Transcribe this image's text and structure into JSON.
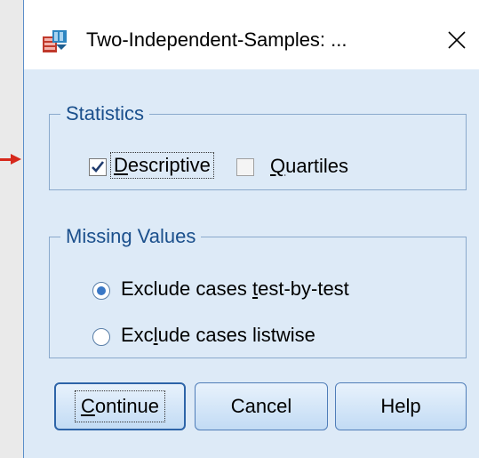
{
  "window": {
    "title": "Two-Independent-Samples: ..."
  },
  "statistics_group": {
    "legend": "Statistics",
    "descriptive": {
      "label_u": "D",
      "label_rest": "escriptive",
      "checked": true
    },
    "quartiles": {
      "label_u": "Q",
      "label_rest": "uartiles",
      "checked": false
    }
  },
  "missing_group": {
    "legend": "Missing Values",
    "option1": {
      "pre": "Exclude cases ",
      "u": "t",
      "post": "est-by-test",
      "selected": true
    },
    "option2": {
      "pre": "Exc",
      "u": "l",
      "post": "ude cases listwise",
      "selected": false
    }
  },
  "buttons": {
    "continue": {
      "u": "C",
      "rest": "ontinue"
    },
    "cancel": "Cancel",
    "help": "Help"
  },
  "colors": {
    "annotation_arrow": "#d6281b",
    "dialog_bg": "#ddeaf7",
    "accent": "#1a4f8c"
  }
}
